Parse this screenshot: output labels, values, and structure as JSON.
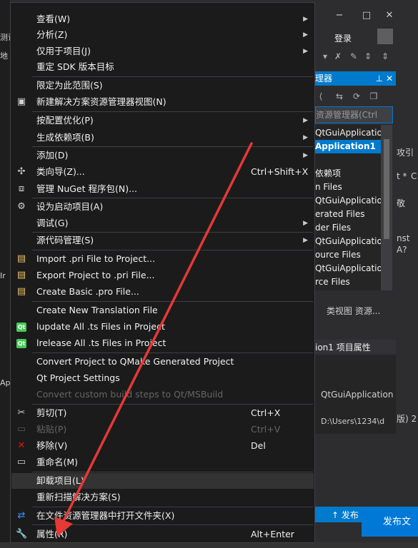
{
  "background": {
    "left_fragments": [
      "测试",
      "地",
      "Ir",
      "Ap"
    ],
    "titlebar_buttons": [
      "−",
      "□",
      "✕"
    ],
    "login_label": "登录",
    "panel_title": "理器",
    "search_placeholder": "资源管理器(Ctrl",
    "tree_items": [
      "QtGuiApplication",
      "Application1",
      "依赖项",
      "n Files",
      "QtGuiApplication",
      "erated Files",
      "der Files",
      "QtGuiApplication",
      "ource Files",
      "QtGuiApplication",
      "rce Files"
    ],
    "side_texts": [
      "攻引",
      "t *",
      "C",
      "敬",
      "nst",
      "A?"
    ],
    "tabs_text": "类视图  资源...",
    "props_head": "",
    "props_title": "ion1  项目属性",
    "prop_value_1": "QtGuiApplication",
    "prop_value_2": "D:\\Users\\1234\\d",
    "prop_side": "版)  2",
    "publish_label": "↑ 发布 ▲",
    "blue_button_label": "发布文"
  },
  "menu": {
    "items": [
      {
        "label": "查看(W)",
        "shortcut": "",
        "submenu": true,
        "icon": "",
        "disabled": false
      },
      {
        "label": "分析(Z)",
        "shortcut": "",
        "submenu": true,
        "icon": "",
        "disabled": false
      },
      {
        "label": "仅用于项目(J)",
        "shortcut": "",
        "submenu": true,
        "icon": "",
        "disabled": false
      },
      {
        "label": "重定 SDK 版本目标",
        "shortcut": "",
        "submenu": false,
        "icon": "",
        "disabled": false
      },
      {
        "label": "限定为此范围(S)",
        "shortcut": "",
        "submenu": false,
        "icon": "",
        "disabled": false
      },
      {
        "label": "新建解决方案资源管理器视图(N)",
        "shortcut": "",
        "submenu": false,
        "icon": "new-view-icon",
        "disabled": false
      },
      {
        "label": "按配置优化(P)",
        "shortcut": "",
        "submenu": true,
        "icon": "",
        "disabled": false
      },
      {
        "label": "生成依赖项(B)",
        "shortcut": "",
        "submenu": true,
        "icon": "",
        "disabled": false
      },
      {
        "label": "添加(D)",
        "shortcut": "",
        "submenu": true,
        "icon": "",
        "disabled": false
      },
      {
        "label": "类向导(Z)...",
        "shortcut": "Ctrl+Shift+X",
        "submenu": false,
        "icon": "class-wizard-icon",
        "disabled": false
      },
      {
        "label": "管理 NuGet 程序包(N)...",
        "shortcut": "",
        "submenu": false,
        "icon": "nuget-icon",
        "disabled": false
      },
      {
        "label": "设为启动项目(A)",
        "shortcut": "",
        "submenu": false,
        "icon": "gear-icon",
        "disabled": false
      },
      {
        "label": "调试(G)",
        "shortcut": "",
        "submenu": true,
        "icon": "",
        "disabled": false
      },
      {
        "label": "源代码管理(S)",
        "shortcut": "",
        "submenu": true,
        "icon": "",
        "disabled": false
      },
      {
        "label": "Import .pri File to Project...",
        "shortcut": "",
        "submenu": false,
        "icon": "import-icon",
        "disabled": false
      },
      {
        "label": "Export Project to .pri File...",
        "shortcut": "",
        "submenu": false,
        "icon": "export-icon",
        "disabled": false
      },
      {
        "label": "Create Basic .pro File...",
        "shortcut": "",
        "submenu": false,
        "icon": "create-pro-icon",
        "disabled": false
      },
      {
        "label": "Create New Translation File",
        "shortcut": "",
        "submenu": false,
        "icon": "",
        "disabled": false
      },
      {
        "label": "lupdate All .ts Files in Project",
        "shortcut": "",
        "submenu": false,
        "icon": "qt-icon",
        "disabled": false
      },
      {
        "label": "lrelease All .ts Files in Project",
        "shortcut": "",
        "submenu": false,
        "icon": "qt-icon",
        "disabled": false
      },
      {
        "label": "Convert Project to QMake Generated Project",
        "shortcut": "",
        "submenu": false,
        "icon": "",
        "disabled": false
      },
      {
        "label": "Qt Project Settings",
        "shortcut": "",
        "submenu": false,
        "icon": "",
        "disabled": false
      },
      {
        "label": "Convert custom build steps to Qt/MSBuild",
        "shortcut": "",
        "submenu": false,
        "icon": "",
        "disabled": true
      },
      {
        "label": "剪切(T)",
        "shortcut": "Ctrl+X",
        "submenu": false,
        "icon": "scissors-icon",
        "disabled": false
      },
      {
        "label": "粘贴(P)",
        "shortcut": "Ctrl+V",
        "submenu": false,
        "icon": "paste-icon",
        "disabled": true
      },
      {
        "label": "移除(V)",
        "shortcut": "Del",
        "submenu": false,
        "icon": "remove-icon",
        "disabled": false
      },
      {
        "label": "重命名(M)",
        "shortcut": "",
        "submenu": false,
        "icon": "rename-icon",
        "disabled": false
      },
      {
        "label": "卸载项目(L)",
        "shortcut": "",
        "submenu": false,
        "icon": "",
        "disabled": false,
        "highlighted": true
      },
      {
        "label": "重新扫描解决方案(S)",
        "shortcut": "",
        "submenu": false,
        "icon": "",
        "disabled": false
      },
      {
        "label": "在文件资源管理器中打开文件夹(X)",
        "shortcut": "",
        "submenu": false,
        "icon": "open-folder-icon",
        "disabled": false
      },
      {
        "label": "属性(R)",
        "shortcut": "Alt+Enter",
        "submenu": false,
        "icon": "wrench-icon",
        "disabled": false
      }
    ]
  },
  "colors": {
    "menu_bg": "#1b1b1c",
    "highlight": "#333334",
    "accent": "#007acc",
    "annotation_arrow": "#e53935"
  }
}
